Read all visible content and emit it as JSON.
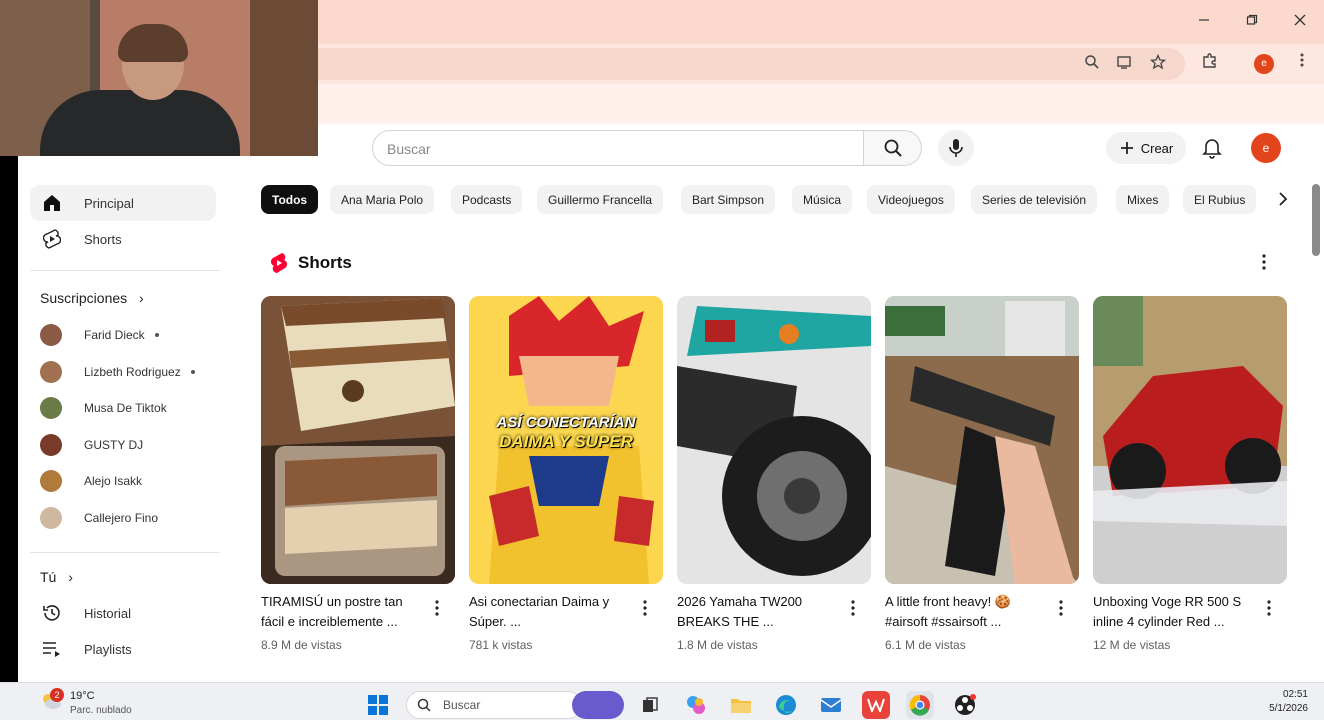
{
  "search": {
    "placeholder": "Buscar"
  },
  "header": {
    "create_label": "Crear",
    "avatar_letter": "e"
  },
  "browser": {
    "profile_letter": "e"
  },
  "sidebar": {
    "main": [
      {
        "label": "Principal",
        "icon": "home-icon"
      },
      {
        "label": "Shorts",
        "icon": "shorts-icon"
      }
    ],
    "subscriptions_title": "Suscripciones",
    "subscriptions": [
      {
        "name": "Farid Dieck",
        "dot": true,
        "color": "#8a5a44"
      },
      {
        "name": "Lizbeth Rodriguez",
        "dot": true,
        "color": "#a07050"
      },
      {
        "name": "Musa De Tiktok",
        "dot": false,
        "color": "#6a7a48"
      },
      {
        "name": "GUSTY DJ",
        "dot": false,
        "color": "#7a3a2a"
      },
      {
        "name": "Alejo Isakk",
        "dot": false,
        "color": "#b07a3a"
      },
      {
        "name": "Callejero Fino",
        "dot": false,
        "color": "#d0b8a0"
      }
    ],
    "you_title": "Tú",
    "you": [
      {
        "label": "Historial",
        "icon": "history-icon"
      },
      {
        "label": "Playlists",
        "icon": "playlists-icon"
      }
    ]
  },
  "chips": [
    "Todos",
    "Ana Maria Polo",
    "Podcasts",
    "Guillermo Francella",
    "Bart Simpson",
    "Música",
    "Videojuegos",
    "Series de televisión",
    "Mixes",
    "El Rubius"
  ],
  "shorts": {
    "title": "Shorts",
    "items": [
      {
        "title": "TIRAMISÚ un postre tan fácil e increiblemente ...",
        "views": "8.9 M de vistas"
      },
      {
        "title": "Asi conectarian Daima y Súper. ...",
        "views": "781 k vistas",
        "thumb_text_1": "ASÍ CONECTARÍAN",
        "thumb_text_2": "DAIMA Y SUPER"
      },
      {
        "title": "2026 Yamaha TW200 BREAKS THE ...",
        "views": "1.8 M de vistas"
      },
      {
        "title": "A little front heavy! 🍪 #airsoft #ssairsoft ...",
        "views": "6.1 M de vistas"
      },
      {
        "title": "Unboxing Voge RR 500 S inline 4 cylinder Red ...",
        "views": "12 M de vistas"
      }
    ]
  },
  "taskbar": {
    "temperature": "19°C",
    "weather": "Parc. nublado",
    "weather_badge": "2",
    "search_label": "Buscar",
    "time": "02:51",
    "date": "5/1/2026"
  },
  "colors": {
    "accent": "#ff0033",
    "avatar": "#e2441c",
    "titlebar": "#fbd9cc"
  }
}
